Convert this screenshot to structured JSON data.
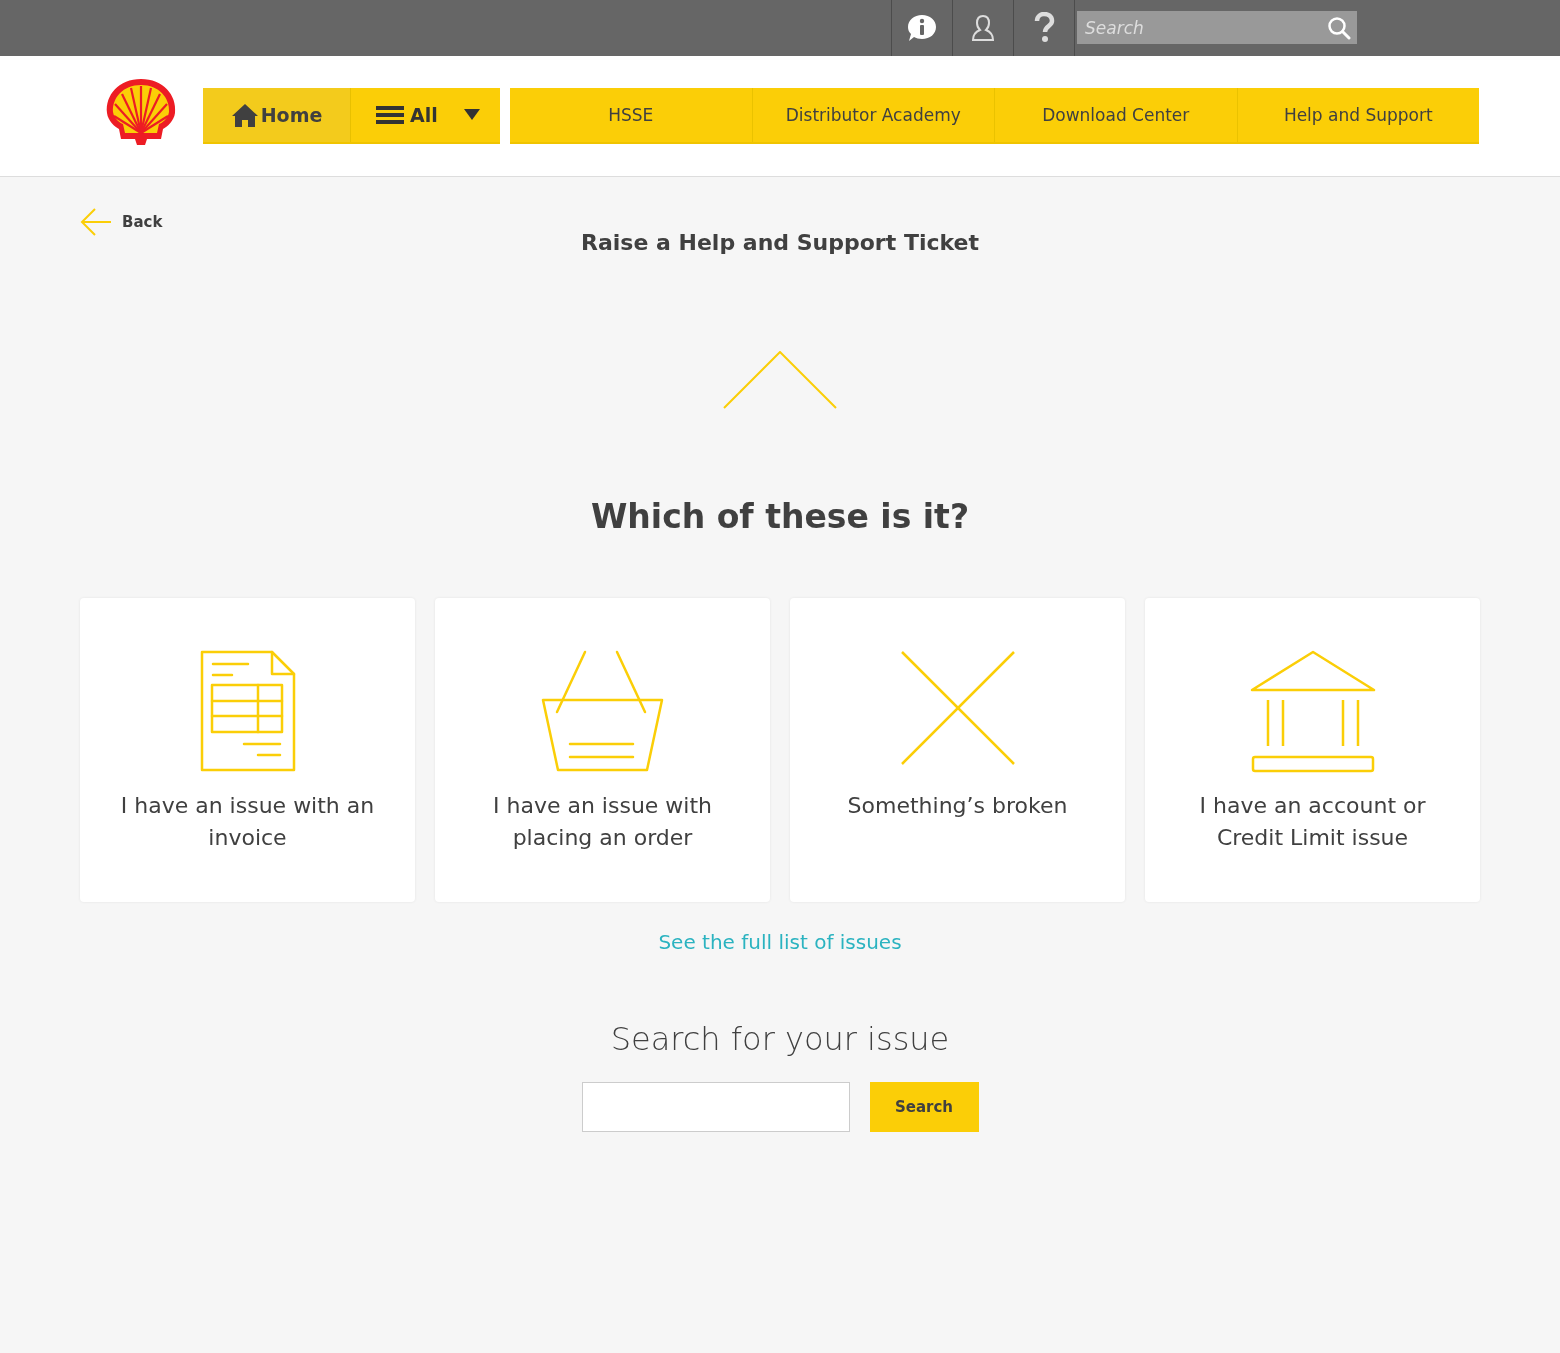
{
  "topbar": {
    "search": {
      "placeholder": "Search"
    }
  },
  "nav": {
    "home": "Home",
    "all": "All",
    "items": [
      {
        "label": "HSSE"
      },
      {
        "label": "Distributor Academy"
      },
      {
        "label": "Download Center"
      },
      {
        "label": "Help and Support"
      }
    ]
  },
  "back": "Back",
  "title": "Raise a Help and Support Ticket",
  "question": "Which of these is it?",
  "cards": [
    {
      "kind": "invoice",
      "label": "I have an issue with an invoice"
    },
    {
      "kind": "basket",
      "label": "I have an issue with placing an order"
    },
    {
      "kind": "broken",
      "label": "Something’s broken"
    },
    {
      "kind": "bank",
      "label": "I have an account or Credit Limit issue"
    }
  ],
  "full_list_link": "See the full list of issues",
  "search_section": {
    "heading": "Search for your issue",
    "button": "Search"
  }
}
